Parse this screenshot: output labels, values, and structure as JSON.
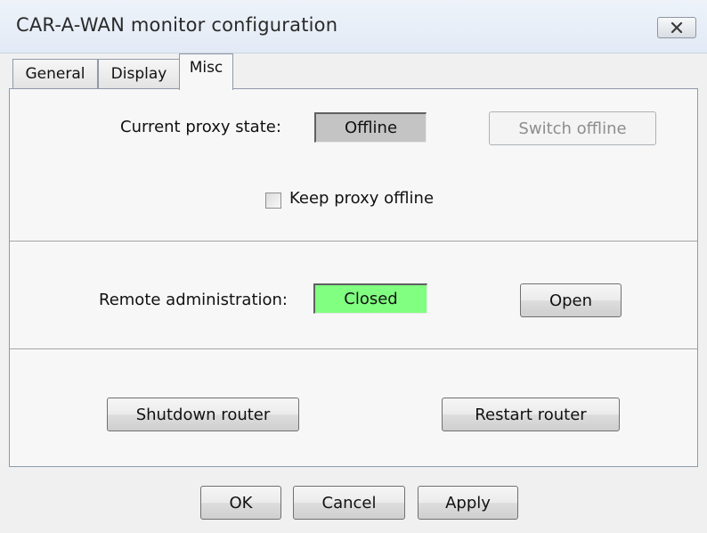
{
  "window": {
    "title": "CAR-A-WAN monitor configuration"
  },
  "tabs": [
    {
      "label": "General",
      "active": false
    },
    {
      "label": "Display",
      "active": false
    },
    {
      "label": "Misc",
      "active": true
    }
  ],
  "proxy": {
    "state_label": "Current proxy state:",
    "state_value": "Offline",
    "state_color": "#c4c4c4",
    "switch_button": "Switch offline",
    "switch_enabled": false,
    "keep_offline_label": "Keep proxy offline",
    "keep_offline_checked": false
  },
  "remote": {
    "label": "Remote administration:",
    "value": "Closed",
    "value_color": "#80ff80",
    "open_button": "Open"
  },
  "router": {
    "shutdown_button": "Shutdown router",
    "restart_button": "Restart router"
  },
  "footer": {
    "ok": "OK",
    "cancel": "Cancel",
    "apply": "Apply"
  },
  "icons": {
    "close": "close-icon"
  }
}
